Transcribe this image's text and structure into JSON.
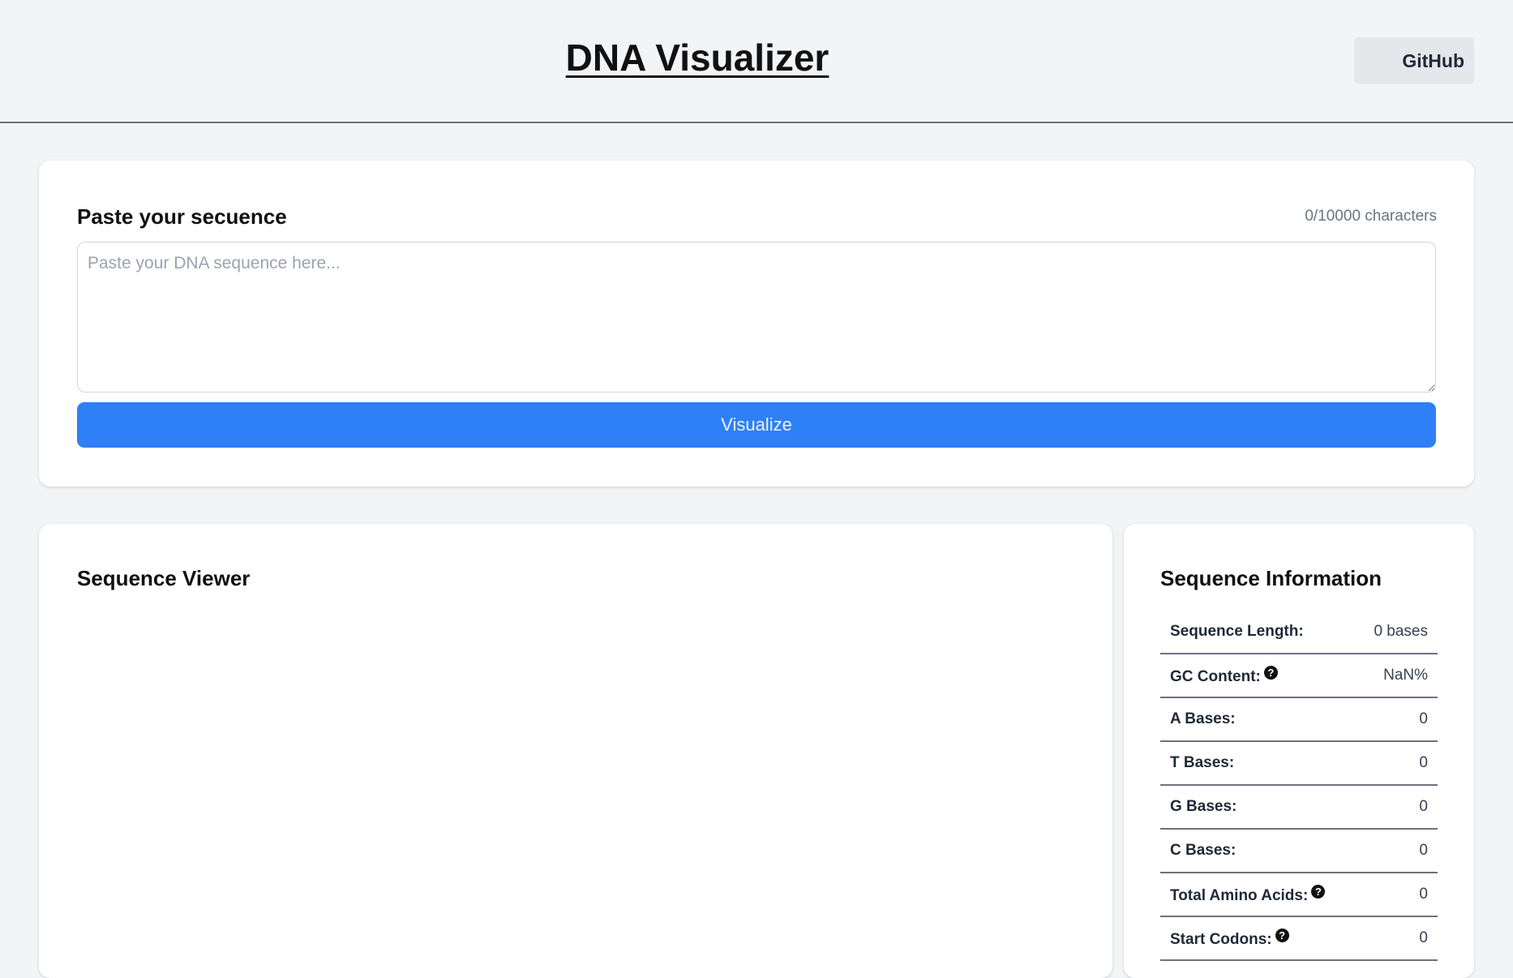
{
  "header": {
    "title": "DNA Visualizer",
    "github_label": "GitHub"
  },
  "input_card": {
    "heading": "Paste your secuence",
    "char_count": "0/10000 characters",
    "placeholder": "Paste your DNA sequence here...",
    "value": "",
    "button_label": "Visualize"
  },
  "viewer": {
    "heading": "Sequence Viewer"
  },
  "info": {
    "heading": "Sequence Information",
    "rows": [
      {
        "label": "Sequence Length:",
        "value": "0 bases",
        "help": false
      },
      {
        "label": "GC Content:",
        "value": "NaN%",
        "help": true
      },
      {
        "label": "A Bases:",
        "value": "0",
        "help": false
      },
      {
        "label": "T Bases:",
        "value": "0",
        "help": false
      },
      {
        "label": "G Bases:",
        "value": "0",
        "help": false
      },
      {
        "label": "C Bases:",
        "value": "0",
        "help": false
      },
      {
        "label": "Total Amino Acids:",
        "value": "0",
        "help": true
      },
      {
        "label": "Start Codons:",
        "value": "0",
        "help": true
      }
    ],
    "help_glyph": "?"
  },
  "colors": {
    "page_bg": "#f3f4f6",
    "card_bg": "#ffffff",
    "accent": "#2f80f6"
  }
}
